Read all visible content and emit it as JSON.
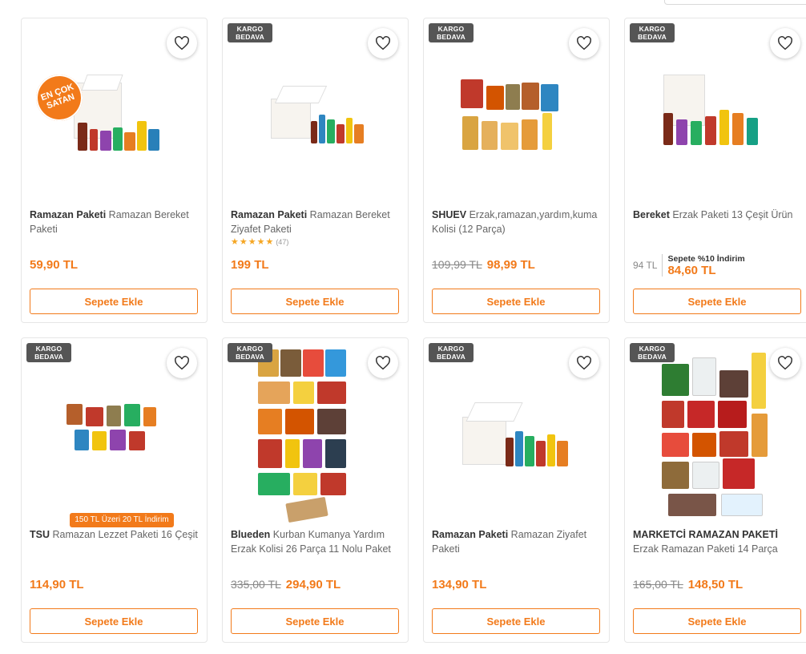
{
  "products": [
    {
      "brand": "Ramazan Paketi",
      "name": "Ramazan Bereket Paketi",
      "price": "59,90 TL",
      "badge": "",
      "sticker": "EN ÇOK SATAN",
      "button": "Sepete Ekle"
    },
    {
      "brand": "Ramazan Paketi",
      "name": "Ramazan Bereket Ziyafet Paketi",
      "price": "199 TL",
      "badge": "KARGO BEDAVA",
      "rating_stars": 5,
      "rating_count": "(47)",
      "button": "Sepete Ekle"
    },
    {
      "brand": "SHUEV",
      "name": "Erzak,ramazan,yardım,kuma Kolisi (12 Parça)",
      "old_price": "109,99 TL",
      "price": "98,99 TL",
      "badge": "KARGO BEDAVA",
      "button": "Sepete Ekle"
    },
    {
      "brand": "Bereket",
      "name": "Erzak Paketi 13 Çeşit Ürün",
      "old_price": "94 TL",
      "discount_label": "Sepete %10 İndirim",
      "price": "84,60 TL",
      "badge": "KARGO BEDAVA",
      "button": "Sepete Ekle"
    },
    {
      "brand": "TSU",
      "name": "Ramazan Lezzet Paketi 16 Çeşit",
      "price": "114,90 TL",
      "badge": "KARGO BEDAVA",
      "promo": "150 TL Üzeri 20 TL İndirim",
      "button": "Sepete Ekle"
    },
    {
      "brand": "Blueden",
      "name": "Kurban Kumanya Yardım Erzak Kolisi 26 Parça 11 Nolu Paket",
      "old_price": "335,00 TL",
      "price": "294,90 TL",
      "badge": "KARGO BEDAVA",
      "button": "Sepete Ekle"
    },
    {
      "brand": "Ramazan Paketi",
      "name": "Ramazan Ziyafet Paketi",
      "price": "134,90 TL",
      "badge": "KARGO BEDAVA",
      "button": "Sepete Ekle"
    },
    {
      "brand": "MARKETCİ RAMAZAN PAKETİ",
      "name": "Erzak Ramazan Paketi 14 Parça",
      "old_price": "165,00 TL",
      "price": "148,50 TL",
      "badge": "KARGO BEDAVA",
      "button": "Sepete Ekle"
    }
  ],
  "colors": {
    "accent": "#f27a1a",
    "badge_bg": "#555555",
    "star": "#f5a623"
  },
  "icons": {
    "favorite": "heart-outline-icon",
    "rating": "star-icon"
  }
}
